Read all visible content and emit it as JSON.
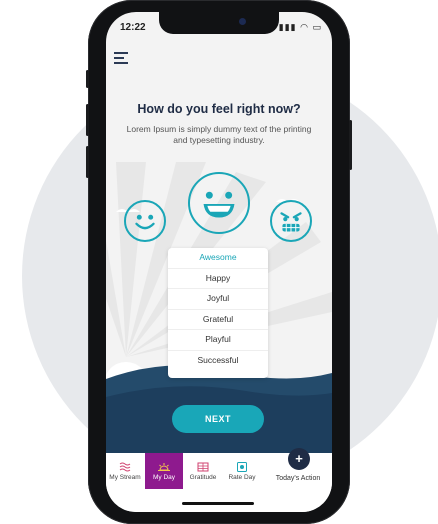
{
  "status_bar": {
    "time": "12:22",
    "icons": "▮▮▮ ◠ ▭"
  },
  "screen": {
    "title": "How do you feel right now?",
    "subtitle": "Lorem Ipsum is simply dummy text of the printing and typesetting industry."
  },
  "moods": {
    "options": [
      "Awesome",
      "Happy",
      "Joyful",
      "Grateful",
      "Playful",
      "Successful"
    ],
    "selected": "Awesome"
  },
  "next_label": "NEXT",
  "tabs": [
    {
      "label": "My Stream",
      "icon": "waves-icon"
    },
    {
      "label": "My Day",
      "icon": "sun-icon"
    },
    {
      "label": "Gratitude",
      "icon": "heart-icon"
    },
    {
      "label": "Rate Day",
      "icon": "rate-icon"
    },
    {
      "label": "Today's Action",
      "icon": "plus-icon"
    }
  ],
  "active_tab": "My Day",
  "colors": {
    "accent": "#1aa6b7",
    "active_tab": "#8e1a8e",
    "navy": "#1f2c45",
    "hill": "#1f4766"
  }
}
